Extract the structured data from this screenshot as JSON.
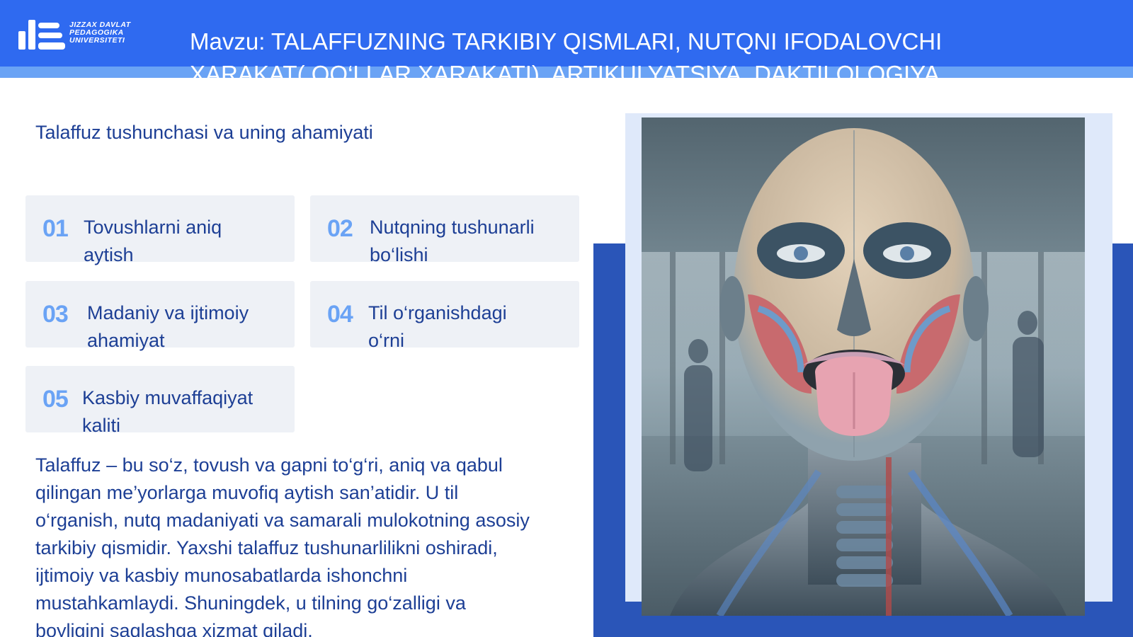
{
  "header": {
    "logo_text": [
      "JIZZAX DAVLAT",
      "PEDAGOGIKA",
      "UNIVERSITETI"
    ],
    "title_line1": "Mavzu: TALAFFUZNING TARKIBIY QISMLARI, NUTQNI IFODALOVCHI",
    "title_line2": "XARAKAT( QO‘LLAR XARAKATI), ARTIKULYATSIYA, DAKTILOLOGIYA"
  },
  "subtitle": "Talaffuz tushunchasi va uning ahamiyati",
  "cards": [
    {
      "num": "01",
      "line1": "Tovushlarni aniq",
      "line2": "aytish"
    },
    {
      "num": "02",
      "line1": "Nutqning tushunarli",
      "line2": "bo‘lishi"
    },
    {
      "num": "03",
      "line1": "Madaniy va ijtimoiy",
      "line2": "ahamiyat"
    },
    {
      "num": "04",
      "line1": "Til o‘rganishdagi",
      "line2": "o‘rni"
    },
    {
      "num": "05",
      "line1": "Kasbiy muvaffaqiyat",
      "line2": "kaliti"
    }
  ],
  "paragraph": [
    "Talaffuz – bu so‘z, tovush va gapni to‘g‘ri, aniq va qabul",
    "qilingan me’yorlarga muvofiq aytish san’atidir. U til",
    "o‘rganish, nutq madaniyati va samarali mulokotning asosiy",
    "tarkibiy qismidir. Yaxshi talaffuz tushunarlilikni oshiradi,",
    "ijtimoiy va kasbiy munosabatlarda ishonchni",
    "mustahkamlaydi. Shuningdek, u tilning go‘zalligi va",
    "boyligini saqlashga xizmat qiladi."
  ],
  "colors": {
    "header_blue": "#2f6af0",
    "accent_light_blue": "#6aa3f5",
    "text_navy": "#1d3f95",
    "card_bg": "#eef1f6",
    "deco_dark_blue": "#2a55b8"
  },
  "icons": {
    "logo": "university-logo-icon",
    "illustration": "head-anatomy-illustration"
  }
}
